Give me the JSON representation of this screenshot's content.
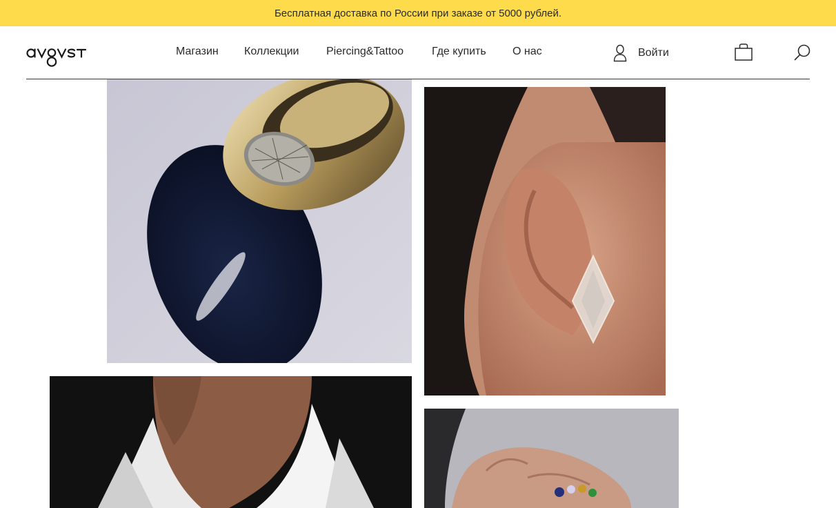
{
  "promo": {
    "text": "Бесплатная доставка по России при заказе от 5000 рублей."
  },
  "header": {
    "logo_text": "avgvst",
    "nav": [
      {
        "label": "Магазин"
      },
      {
        "label": "Коллекции"
      },
      {
        "label": "Piercing&Tattoo"
      },
      {
        "label": "Где купить"
      },
      {
        "label": "О нас"
      }
    ],
    "login_label": "Войти",
    "icons": {
      "user": "user-icon",
      "cart": "shopping-bag-icon",
      "search": "search-icon"
    }
  },
  "gallery": {
    "photos": [
      {
        "subject": "gold ring with rutilated quartz"
      },
      {
        "subject": "ear with crystal earring"
      },
      {
        "subject": "neck and white collar"
      },
      {
        "subject": "hand with multi-stone ring"
      }
    ]
  },
  "colors": {
    "promo_bg": "#fddb4a",
    "text": "#2a2a2a",
    "divider": "#3a3a3a"
  }
}
